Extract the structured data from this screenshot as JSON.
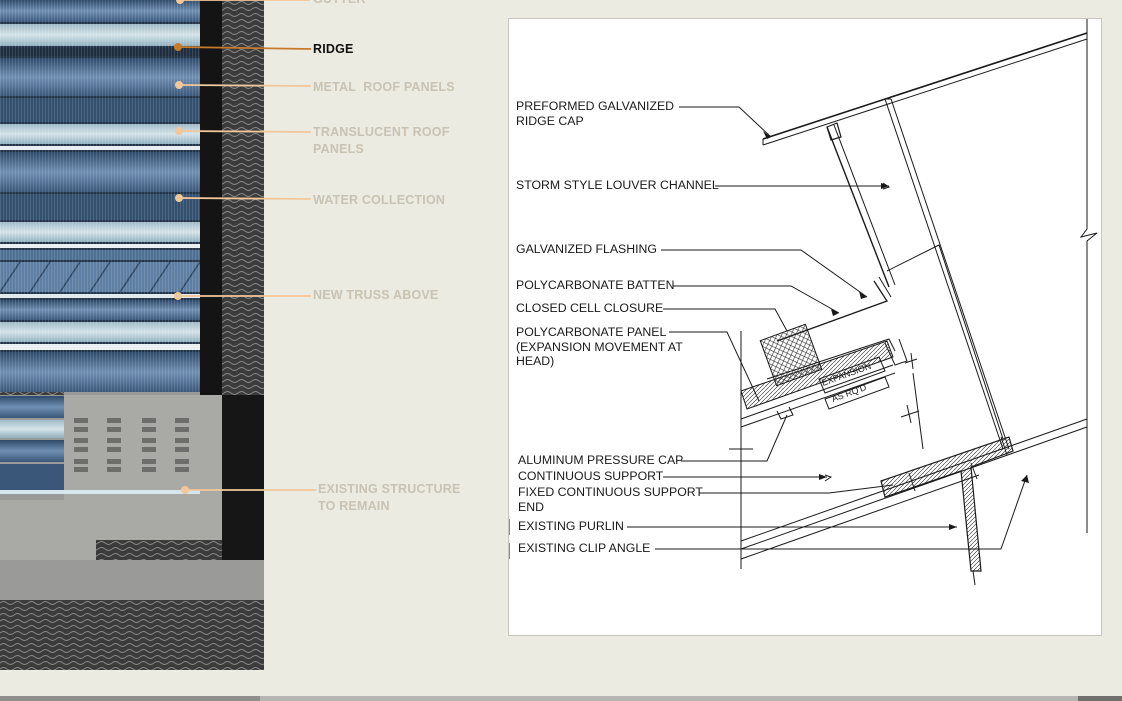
{
  "plan_callouts": [
    {
      "key": "gutter",
      "text": "GUTTER"
    },
    {
      "key": "ridge",
      "text": "RIDGE"
    },
    {
      "key": "metal",
      "text": "METAL  ROOF PANELS"
    },
    {
      "key": "translucent",
      "text": "TRANSLUCENT ROOF\nPANELS"
    },
    {
      "key": "water",
      "text": "WATER COLLECTION"
    },
    {
      "key": "truss",
      "text": "NEW TRUSS ABOVE"
    },
    {
      "key": "existing",
      "text": "EXISTING STRUCTURE\nTO REMAIN"
    }
  ],
  "colors": {
    "leader_active": "#c87a2b",
    "leader_inactive": "#f2c79a",
    "text_inactive": "#c8c3b3",
    "background": "#ecebe1"
  },
  "detail_labels": [
    {
      "key": "ridge_cap",
      "text": "PREFORMED GALVANIZED\nRIDGE CAP"
    },
    {
      "key": "louver",
      "text": "STORM STYLE LOUVER CHANNEL"
    },
    {
      "key": "flashing",
      "text": "GALVANIZED FLASHING"
    },
    {
      "key": "batten",
      "text": "POLYCARBONATE BATTEN"
    },
    {
      "key": "closure",
      "text": "CLOSED CELL CLOSURE"
    },
    {
      "key": "panel",
      "text": "POLYCARBONATE PANEL\n(EXPANSION MOVEMENT AT\nHEAD)"
    },
    {
      "key": "pressure_cap",
      "text": "ALUMINUM PRESSURE CAP"
    },
    {
      "key": "cont_support",
      "text": "CONTINUOUS SUPPORT"
    },
    {
      "key": "fixed_support",
      "text": "FIXED CONTINUOUS SUPPORT\nEND"
    },
    {
      "key": "purlin",
      "text": "EXISTING PURLIN"
    },
    {
      "key": "clip",
      "text": "EXISTING CLIP ANGLE"
    }
  ],
  "detail_notes": {
    "expansion_1": "EXPANSION",
    "expansion_2": "AS  RQ'D"
  }
}
